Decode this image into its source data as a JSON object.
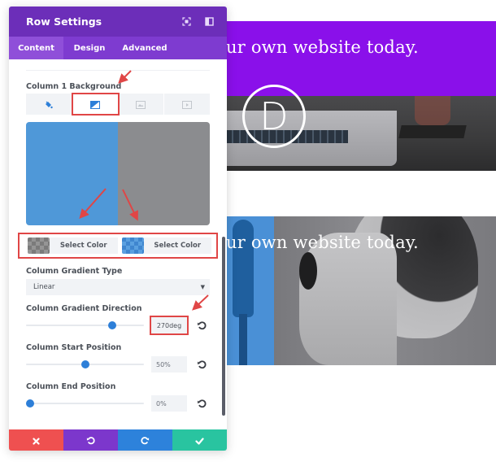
{
  "preview": {
    "headline_1": "ur own website today.",
    "logo_letter": "D",
    "headline_2": "ur own website today."
  },
  "panel": {
    "title": "Row Settings",
    "header_icons": [
      "expand-icon",
      "sidebar-toggle-icon"
    ],
    "tabs": [
      {
        "label": "Content",
        "active": true
      },
      {
        "label": "Design",
        "active": false
      },
      {
        "label": "Advanced",
        "active": false
      }
    ],
    "background": {
      "label": "Column 1 Background",
      "types": [
        {
          "name": "color",
          "icon": "paint-bucket-icon",
          "active": false
        },
        {
          "name": "gradient",
          "icon": "gradient-icon",
          "active": true
        },
        {
          "name": "image",
          "icon": "image-icon",
          "active": false
        },
        {
          "name": "video",
          "icon": "video-icon",
          "active": false
        }
      ],
      "gradient_colors": {
        "start": "#4f98d8",
        "end": "#8b8c8f"
      },
      "color_pickers": [
        {
          "label": "Select Color",
          "swatch": "gray-transparent"
        },
        {
          "label": "Select Color",
          "swatch": "blue-transparent"
        }
      ]
    },
    "gradient_type": {
      "label": "Column Gradient Type",
      "value": "Linear"
    },
    "gradient_direction": {
      "label": "Column Gradient Direction",
      "value": "270deg",
      "fraction": 0.75
    },
    "start_position": {
      "label": "Column Start Position",
      "value": "50%",
      "fraction": 0.5
    },
    "end_position": {
      "label": "Column End Position",
      "value": "0%",
      "fraction": 0.0
    },
    "footer": {
      "cancel": "close-icon",
      "undo": "undo-icon",
      "redo": "redo-icon",
      "save": "check-icon"
    }
  },
  "colors": {
    "header": "#6c2eb9",
    "tabs": "#7e3bd0",
    "highlight": "#e04646",
    "accent": "#2d7fd8"
  }
}
